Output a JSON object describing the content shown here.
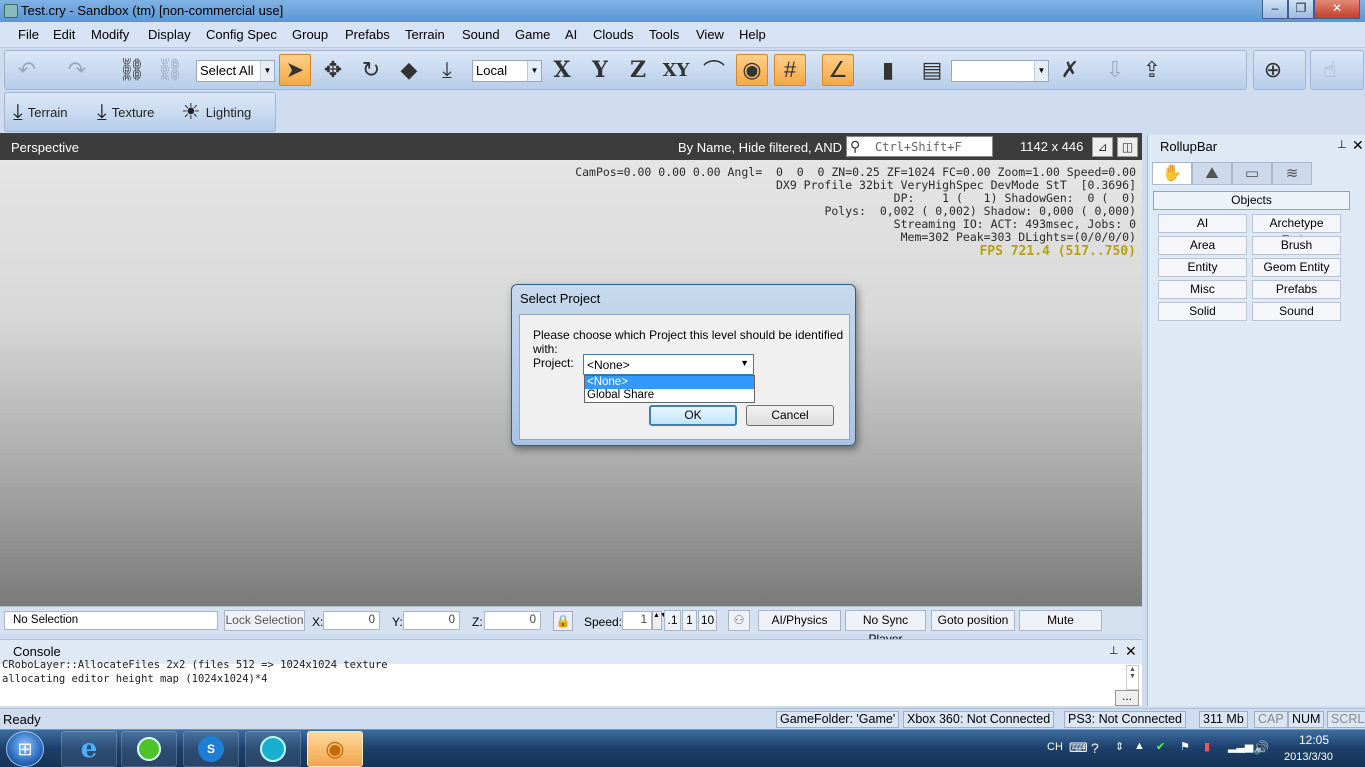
{
  "window": {
    "title": "Test.cry - Sandbox (tm) [non-commercial use]",
    "minimize": "‒",
    "maximize": "❐",
    "close": "✕"
  },
  "menu": [
    "File",
    "Edit",
    "Modify",
    "Display",
    "Config Spec",
    "Group",
    "Prefabs",
    "Terrain",
    "Sound",
    "Game",
    "AI",
    "Clouds",
    "Tools",
    "View",
    "Help"
  ],
  "toolbar": {
    "select_combo": "Select All",
    "coord_combo": "Local",
    "axis_x": "X",
    "axis_y": "Y",
    "axis_z": "Z",
    "axis_xy": "XY",
    "icons": [
      "undo-icon",
      "redo-icon",
      "link-icon",
      "unlink-icon",
      "select-arrow-icon",
      "move-icon",
      "rotate-icon",
      "scale-icon",
      "drop-to-ground-icon",
      "snap-surface-icon",
      "camera-icon",
      "grid-snap-icon",
      "angle-snap-icon",
      "ruler-icon",
      "layer-icon",
      "delete-icon",
      "export-icon",
      "reload-icon",
      "help-lifebuoy-icon",
      "cursor-icon"
    ]
  },
  "toolbar2": {
    "terrain": "Terrain",
    "texture": "Texture",
    "lighting": "Lighting"
  },
  "viewport": {
    "name": "Perspective",
    "filter": "By Name, Hide filtered, AND",
    "search_placeholder": "Ctrl+Shift+F",
    "resolution": "1142 x 446",
    "overlay": [
      "CamPos=0.00 0.00 0.00 Angl=  0  0  0 ZN=0.25 ZF=1024 FC=0.00 Zoom=1.00 Speed=0.00",
      "DX9 Profile 32bit VeryHighSpec DevMode StT  [0.3696]",
      "DP:    1 (   1) ShadowGen:  0 (  0)",
      "Polys:  0,002 ( 0,002) Shadow: 0,000 ( 0,000)",
      "Streaming IO: ACT: 493msec, Jobs: 0",
      "Mem=302 Peak=303 DLights=(0/0/0/0)"
    ],
    "fps": "FPS 721.4 (517..750)"
  },
  "dialog": {
    "title": "Select Project",
    "prompt": "Please choose which Project this level should be identified with:",
    "project_label": "Project:",
    "selected": "<None>",
    "options": [
      "<None>",
      "Global Share"
    ],
    "ok": "OK",
    "cancel": "Cancel"
  },
  "rollup": {
    "title": "RollupBar",
    "section": "Objects",
    "buttons": [
      "AI",
      "Archetype Entity",
      "Area",
      "Brush",
      "Entity",
      "Geom Entity",
      "Misc",
      "Prefabs",
      "Solid",
      "Sound"
    ]
  },
  "bottom": {
    "selection": "No Selection",
    "lock": "Lock Selection",
    "x_label": "X:",
    "x_val": "0",
    "y_label": "Y:",
    "y_val": "0",
    "z_label": "Z:",
    "z_val": "0",
    "speed_label": "Speed:",
    "speed_val": "1",
    "speed_opts": [
      ".1",
      "1",
      "10"
    ],
    "ai_physics": "AI/Physics",
    "no_sync": "No Sync Player",
    "goto": "Goto position",
    "mute": "Mute"
  },
  "console": {
    "title": "Console",
    "lines": [
      "CRoboLayer::AllocateFiles 2x2 (files 512 => 1024x1024 texture",
      "allocating editor height map (1024x1024)*4"
    ],
    "more": "..."
  },
  "status": {
    "ready": "Ready",
    "game_folder": "GameFolder: 'Game'",
    "xbox": "Xbox 360: Not Connected",
    "ps3": "PS3: Not Connected",
    "mem": "311 Mb",
    "cap": "CAP",
    "num": "NUM",
    "scrl": "SCRL"
  },
  "taskbar": {
    "lang": "CH",
    "time": "12:05",
    "date": "2013/3/30"
  }
}
